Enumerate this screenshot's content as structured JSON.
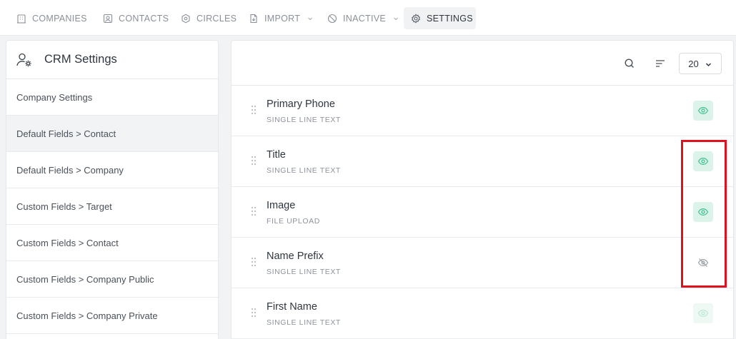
{
  "nav": {
    "items": [
      {
        "label": "COMPANIES",
        "icon": "building-icon"
      },
      {
        "label": "CONTACTS",
        "icon": "contact-card-icon"
      },
      {
        "label": "CIRCLES",
        "icon": "hexagon-icon"
      },
      {
        "label": "IMPORT",
        "icon": "file-import-icon",
        "dropdown": true
      },
      {
        "label": "INACTIVE",
        "icon": "ban-icon",
        "dropdown": true
      },
      {
        "label": "SETTINGS",
        "icon": "gear-icon",
        "active": true
      }
    ]
  },
  "sidebar": {
    "title": "CRM Settings",
    "items": [
      {
        "label": "Company Settings"
      },
      {
        "label": "Default Fields > Contact",
        "active": true
      },
      {
        "label": "Default Fields > Company"
      },
      {
        "label": "Custom Fields > Target"
      },
      {
        "label": "Custom Fields > Contact"
      },
      {
        "label": "Custom Fields > Company Public"
      },
      {
        "label": "Custom Fields > Company Private"
      }
    ]
  },
  "toolbar": {
    "page_size": "20"
  },
  "fields": [
    {
      "name": "Primary Phone",
      "type": "SINGLE LINE TEXT",
      "visibility": "visible"
    },
    {
      "name": "Title",
      "type": "SINGLE LINE TEXT",
      "visibility": "visible"
    },
    {
      "name": "Image",
      "type": "FILE UPLOAD",
      "visibility": "visible"
    },
    {
      "name": "Name Prefix",
      "type": "SINGLE LINE TEXT",
      "visibility": "hidden"
    },
    {
      "name": "First Name",
      "type": "SINGLE LINE TEXT",
      "visibility": "visible-disabled"
    }
  ],
  "colors": {
    "accent_green": "#3fbf8f",
    "visible_bg": "#dcf3ea",
    "highlight_red": "#e0101f"
  }
}
